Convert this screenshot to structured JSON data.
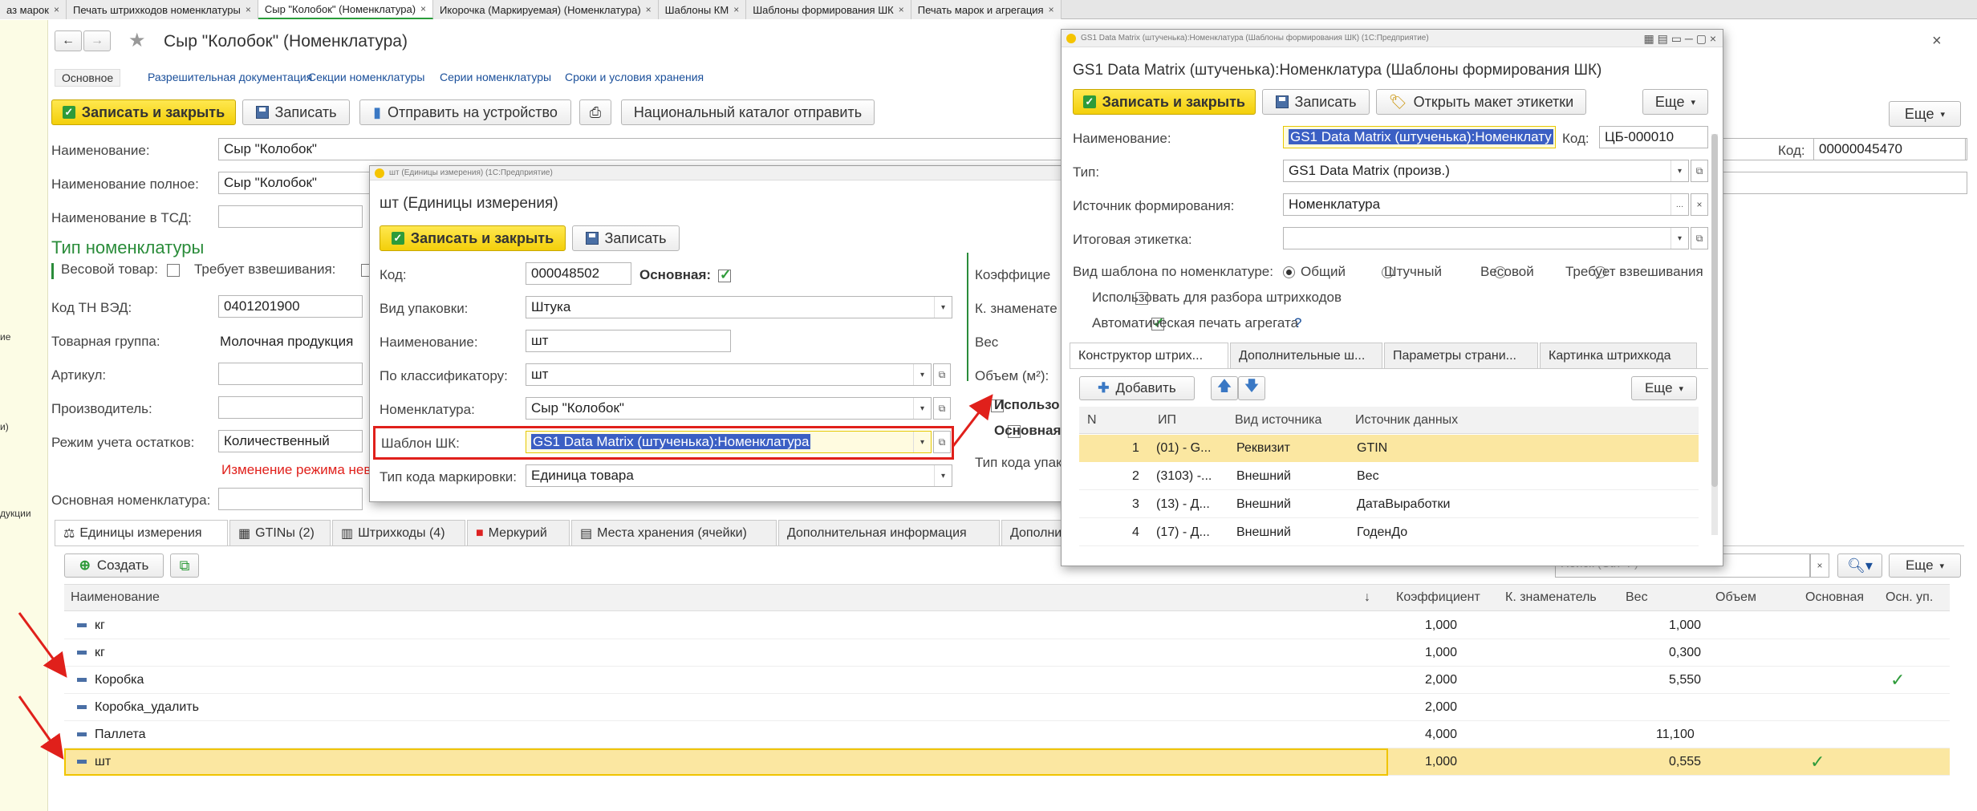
{
  "top_tabs": [
    {
      "label": "аз марок",
      "close": "×"
    },
    {
      "label": "Печать штрихкодов номенклатуры",
      "close": "×"
    },
    {
      "label": "Сыр \"Колобок\" (Номенклатура)",
      "close": "×"
    },
    {
      "label": "Икорочка (Маркируемая) (Номенклатура)",
      "close": "×"
    },
    {
      "label": "Шаблоны КМ",
      "close": "×"
    },
    {
      "label": "Шаблоны формирования ШК",
      "close": "×"
    },
    {
      "label": "Печать марок и агрегация",
      "close": "×"
    }
  ],
  "left_strip": [
    "ие",
    "и)",
    "дукции"
  ],
  "main": {
    "title": "Сыр \"Колобок\" (Номенклатура)",
    "star": "★",
    "nav_tabs": [
      "Основное",
      "Разрешительная документация",
      "Секции номенклатуры",
      "Серии номенклатуры",
      "Сроки и условия хранения"
    ],
    "toolbar": {
      "save_close": "Записать и закрыть",
      "save": "Записать",
      "send": "Отправить на устройство",
      "catalog": "Национальный каталог отправить",
      "more": "Еще"
    },
    "fields": {
      "name_label": "Наименование:",
      "name_value": "Сыр \"Колобок\"",
      "fullname_label": "Наименование полное:",
      "fullname_value": "Сыр \"Колобок\"",
      "tsd_label": "Наименование в ТСД:",
      "code_label": "Код:",
      "code_value": "00000045470",
      "type_header": "Тип номенклатуры",
      "weight_label": "Весовой товар:",
      "weighing_label": "Требует взвешивания:",
      "tnved_label": "Код ТН ВЭД:",
      "tnved_value": "0401201900",
      "group_label": "Товарная группа:",
      "group_value": "Молочная продукция",
      "article_label": "Артикул:",
      "producer_label": "Производитель:",
      "mode_label": "Режим учета остатков:",
      "mode_value": "Количественный",
      "mode_warning": "Изменение режима нево",
      "base_label": "Основная номенклатура:"
    },
    "bottom_tabs": [
      "Единицы измерения",
      "GTINы (2)",
      "Штрихкоды (4)",
      "Меркурий",
      "Места хранения (ячейки)",
      "Дополнительная информация",
      "Дополни"
    ],
    "create_btn": "Создать",
    "search_placeholder": "Поиск (Ctrl+F)",
    "table": {
      "headers": [
        "Наименование",
        "Коэффициент",
        "К. знаменатель",
        "Вес",
        "Объем",
        "Основная",
        "Осн. уп."
      ],
      "sort_arrow": "↓",
      "rows": [
        {
          "name": "кг",
          "coef": "1,000",
          "weight": "1,000",
          "main": "",
          "main_pack": ""
        },
        {
          "name": "кг",
          "coef": "1,000",
          "weight": "0,300",
          "main": "",
          "main_pack": ""
        },
        {
          "name": "Коробка",
          "coef": "2,000",
          "weight": "5,550",
          "main": "",
          "main_pack": "✓"
        },
        {
          "name": "Коробка_удалить",
          "coef": "2,000",
          "weight": "",
          "main": "",
          "main_pack": ""
        },
        {
          "name": "Паллета",
          "coef": "4,000",
          "weight": "11,100",
          "main": "",
          "main_pack": ""
        },
        {
          "name": "шт",
          "coef": "1,000",
          "weight": "0,555",
          "main": "✓",
          "main_pack": ""
        }
      ]
    }
  },
  "unit_dialog": {
    "window_title": "шт (Единицы измерения) (1С:Предприятие)",
    "title": "шт (Единицы измерения)",
    "save_close": "Записать и закрыть",
    "save": "Записать",
    "code_label": "Код:",
    "code_value": "000048502",
    "main_label": "Основная:",
    "pack_label": "Вид упаковки:",
    "pack_value": "Штука",
    "name_label": "Наименование:",
    "name_value": "шт",
    "classifier_label": "По классификатору:",
    "classifier_value": "шт",
    "nomen_label": "Номенклатура:",
    "nomen_value": "Сыр \"Колобок\"",
    "template_label": "Шаблон ШК:",
    "template_value": "GS1 Data Matrix (штученька):Номенклатура",
    "marking_label": "Тип кода маркировки:",
    "marking_value": "Единица товара",
    "right_labels": [
      "Коэффицие",
      "К. знаменате",
      "Вес",
      "Объем (м²):",
      "Использо",
      "Основная",
      "Тип кода упак"
    ]
  },
  "gs1_dialog": {
    "window_title": "GS1 Data Matrix (штученька):Номенклатура (Шаблоны формирования ШК) (1С:Предприятие)",
    "title": "GS1 Data Matrix (штученька):Номенклатура (Шаблоны формирования ШК)",
    "save_close": "Записать и закрыть",
    "save": "Записать",
    "open_layout": "Открыть макет этикетки",
    "more": "Еще",
    "name_label": "Наименование:",
    "name_value": "GS1 Data Matrix (штученька):Номенклату",
    "code_label": "Код:",
    "code_value": "ЦБ-000010",
    "type_label": "Тип:",
    "type_value": "GS1 Data Matrix (произв.)",
    "source_label": "Источник формирования:",
    "source_value": "Номенклатура",
    "final_label": "Итоговая этикетка:",
    "kind_label": "Вид шаблона по номенклатуре:",
    "radios": [
      "Общий",
      "Штучный",
      "Весовой",
      "Требует взвешивания"
    ],
    "use_parse": "Использовать для разбора штрихкодов",
    "auto_print": "Автоматическая печать агрегата",
    "help": "?",
    "tabs": [
      "Конструктор штрих...",
      "Дополнительные ш...",
      "Параметры страни...",
      "Картинка штрихкода"
    ],
    "add": "Добавить",
    "table_more": "Еще",
    "headers": [
      "N",
      "ИП",
      "Вид источника",
      "Источник данных"
    ],
    "rows": [
      {
        "n": "1",
        "ip": "(01) - G...",
        "kind": "Реквизит",
        "src": "GTIN"
      },
      {
        "n": "2",
        "ip": "(3103) -...",
        "kind": "Внешний",
        "src": "Вес"
      },
      {
        "n": "3",
        "ip": "(13) - Д...",
        "kind": "Внешний",
        "src": "ДатаВыработки"
      },
      {
        "n": "4",
        "ip": "(17) - Д...",
        "kind": "Внешний",
        "src": "ГоденДо"
      }
    ]
  },
  "colors": {
    "accent_yellow": "#f5d400",
    "highlight_row": "#fbe7a1",
    "annotation_red": "#e0201b",
    "link_blue": "#1a4f9a",
    "check_green": "#2e9b3a"
  }
}
